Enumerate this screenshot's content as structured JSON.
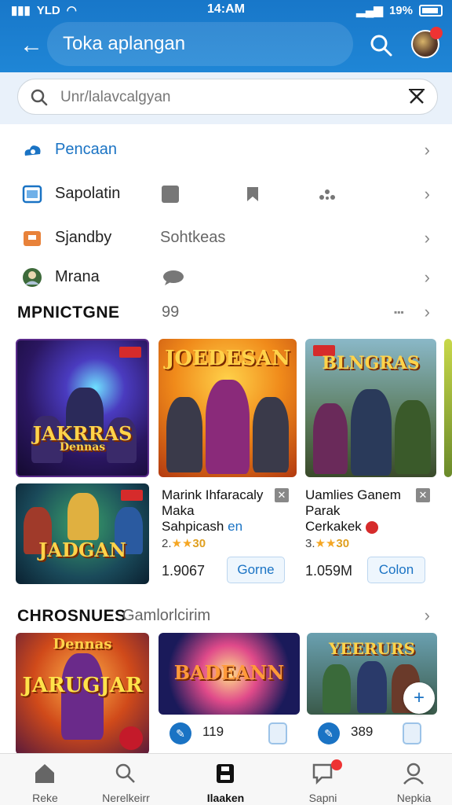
{
  "status_bar": {
    "carrier": "YLD",
    "time": "14:AM",
    "battery": "19%"
  },
  "app_bar": {
    "title": "Toka aplangan"
  },
  "search": {
    "placeholder": "Unr/lalavcalgyan"
  },
  "menu": [
    {
      "label": "Pencaan",
      "icon": "cloud-icon",
      "color": "#1a73c4"
    },
    {
      "label": "Sapolatin",
      "icon": "screen-icon",
      "color": "#1a73c4"
    },
    {
      "label": "Sjandby",
      "extra": "Sohtkeas",
      "icon": "box-icon",
      "color": "#e8823a"
    },
    {
      "label": "Mrana",
      "icon": "avatar-icon",
      "color": "#4a8a3a"
    }
  ],
  "section1": {
    "title": "MPNICTGNE",
    "count": "99"
  },
  "games": [
    {
      "name_line1": "Marink Ihfaracaly",
      "name_line2": "Maka",
      "name_line3": "Sahpicash",
      "name_suffix": "en",
      "rating_prefix": "2.",
      "stars": "★★",
      "rating": "30",
      "count": "1.9067",
      "button": "Gorne"
    },
    {
      "name_line1": "Uamlies Ganem",
      "name_line2": "Parak",
      "name_line3": "Cerkakek",
      "rating_prefix": "3.",
      "stars": "★★",
      "rating": "30",
      "count": "1.059M",
      "button": "Colon"
    }
  ],
  "art_titles": [
    "JAKRRAS",
    "JOEDESAN",
    "BLNGRAS",
    "JADGAN",
    "JARUGJAR",
    "BADEANN",
    "YEERURS"
  ],
  "art_subtitles": [
    "Dennas"
  ],
  "section2": {
    "title": "CHROSNUES",
    "subtitle": "Gamlorlcirim"
  },
  "bottom_cards": [
    {
      "count": "119"
    },
    {
      "count": "389"
    }
  ],
  "bottom_nav": [
    {
      "label": "Reke",
      "icon": "home-icon"
    },
    {
      "label": "Nerelkeirr",
      "icon": "search-person-icon"
    },
    {
      "label": "Ilaaken",
      "icon": "save-icon",
      "active": true
    },
    {
      "label": "Sapni",
      "icon": "notification-icon"
    },
    {
      "label": "Nepkia",
      "icon": "profile-icon"
    }
  ],
  "colors": {
    "primary": "#1877c9",
    "accent": "#1a73c4",
    "star": "#f5a623",
    "badge": "#d62b2b"
  }
}
